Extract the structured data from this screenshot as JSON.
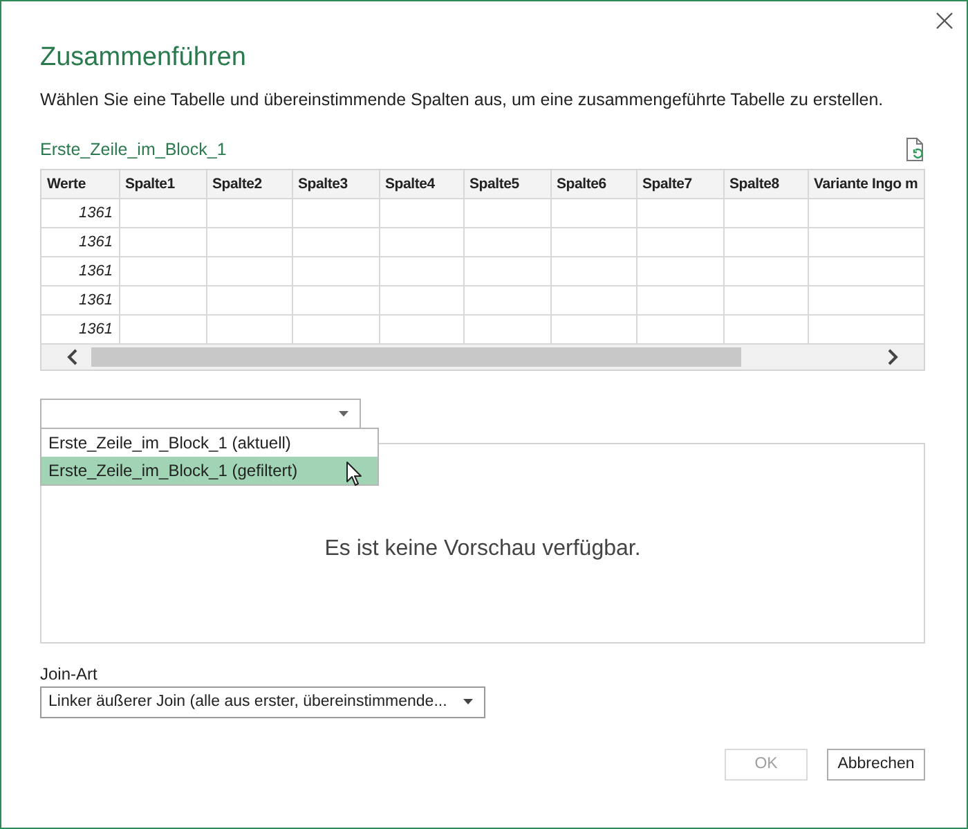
{
  "dialog": {
    "title": "Zusammenführen",
    "description": "Wählen Sie eine Tabelle und übereinstimmende Spalten aus, um eine zusammengeführte Tabelle zu erstellen."
  },
  "table": {
    "name": "Erste_Zeile_im_Block_1",
    "columns": [
      "Werte",
      "Spalte1",
      "Spalte2",
      "Spalte3",
      "Spalte4",
      "Spalte5",
      "Spalte6",
      "Spalte7",
      "Spalte8",
      "Variante Ingo m"
    ],
    "rows": [
      {
        "werte": "1361"
      },
      {
        "werte": "1361"
      },
      {
        "werte": "1361"
      },
      {
        "werte": "1361"
      },
      {
        "werte": "1361"
      }
    ]
  },
  "second_table": {
    "expanded": true,
    "options": [
      {
        "label": "Erste_Zeile_im_Block_1 (aktuell)",
        "selected": false
      },
      {
        "label": "Erste_Zeile_im_Block_1 (gefiltert)",
        "selected": true
      }
    ]
  },
  "preview": {
    "message": "Es ist keine Vorschau verfügbar."
  },
  "join": {
    "label": "Join-Art",
    "value": "Linker äußerer Join (alle aus erster, übereinstimmende..."
  },
  "buttons": [
    {
      "label": "OK",
      "disabled": true
    },
    {
      "label": "Abbrechen",
      "disabled": false
    }
  ]
}
